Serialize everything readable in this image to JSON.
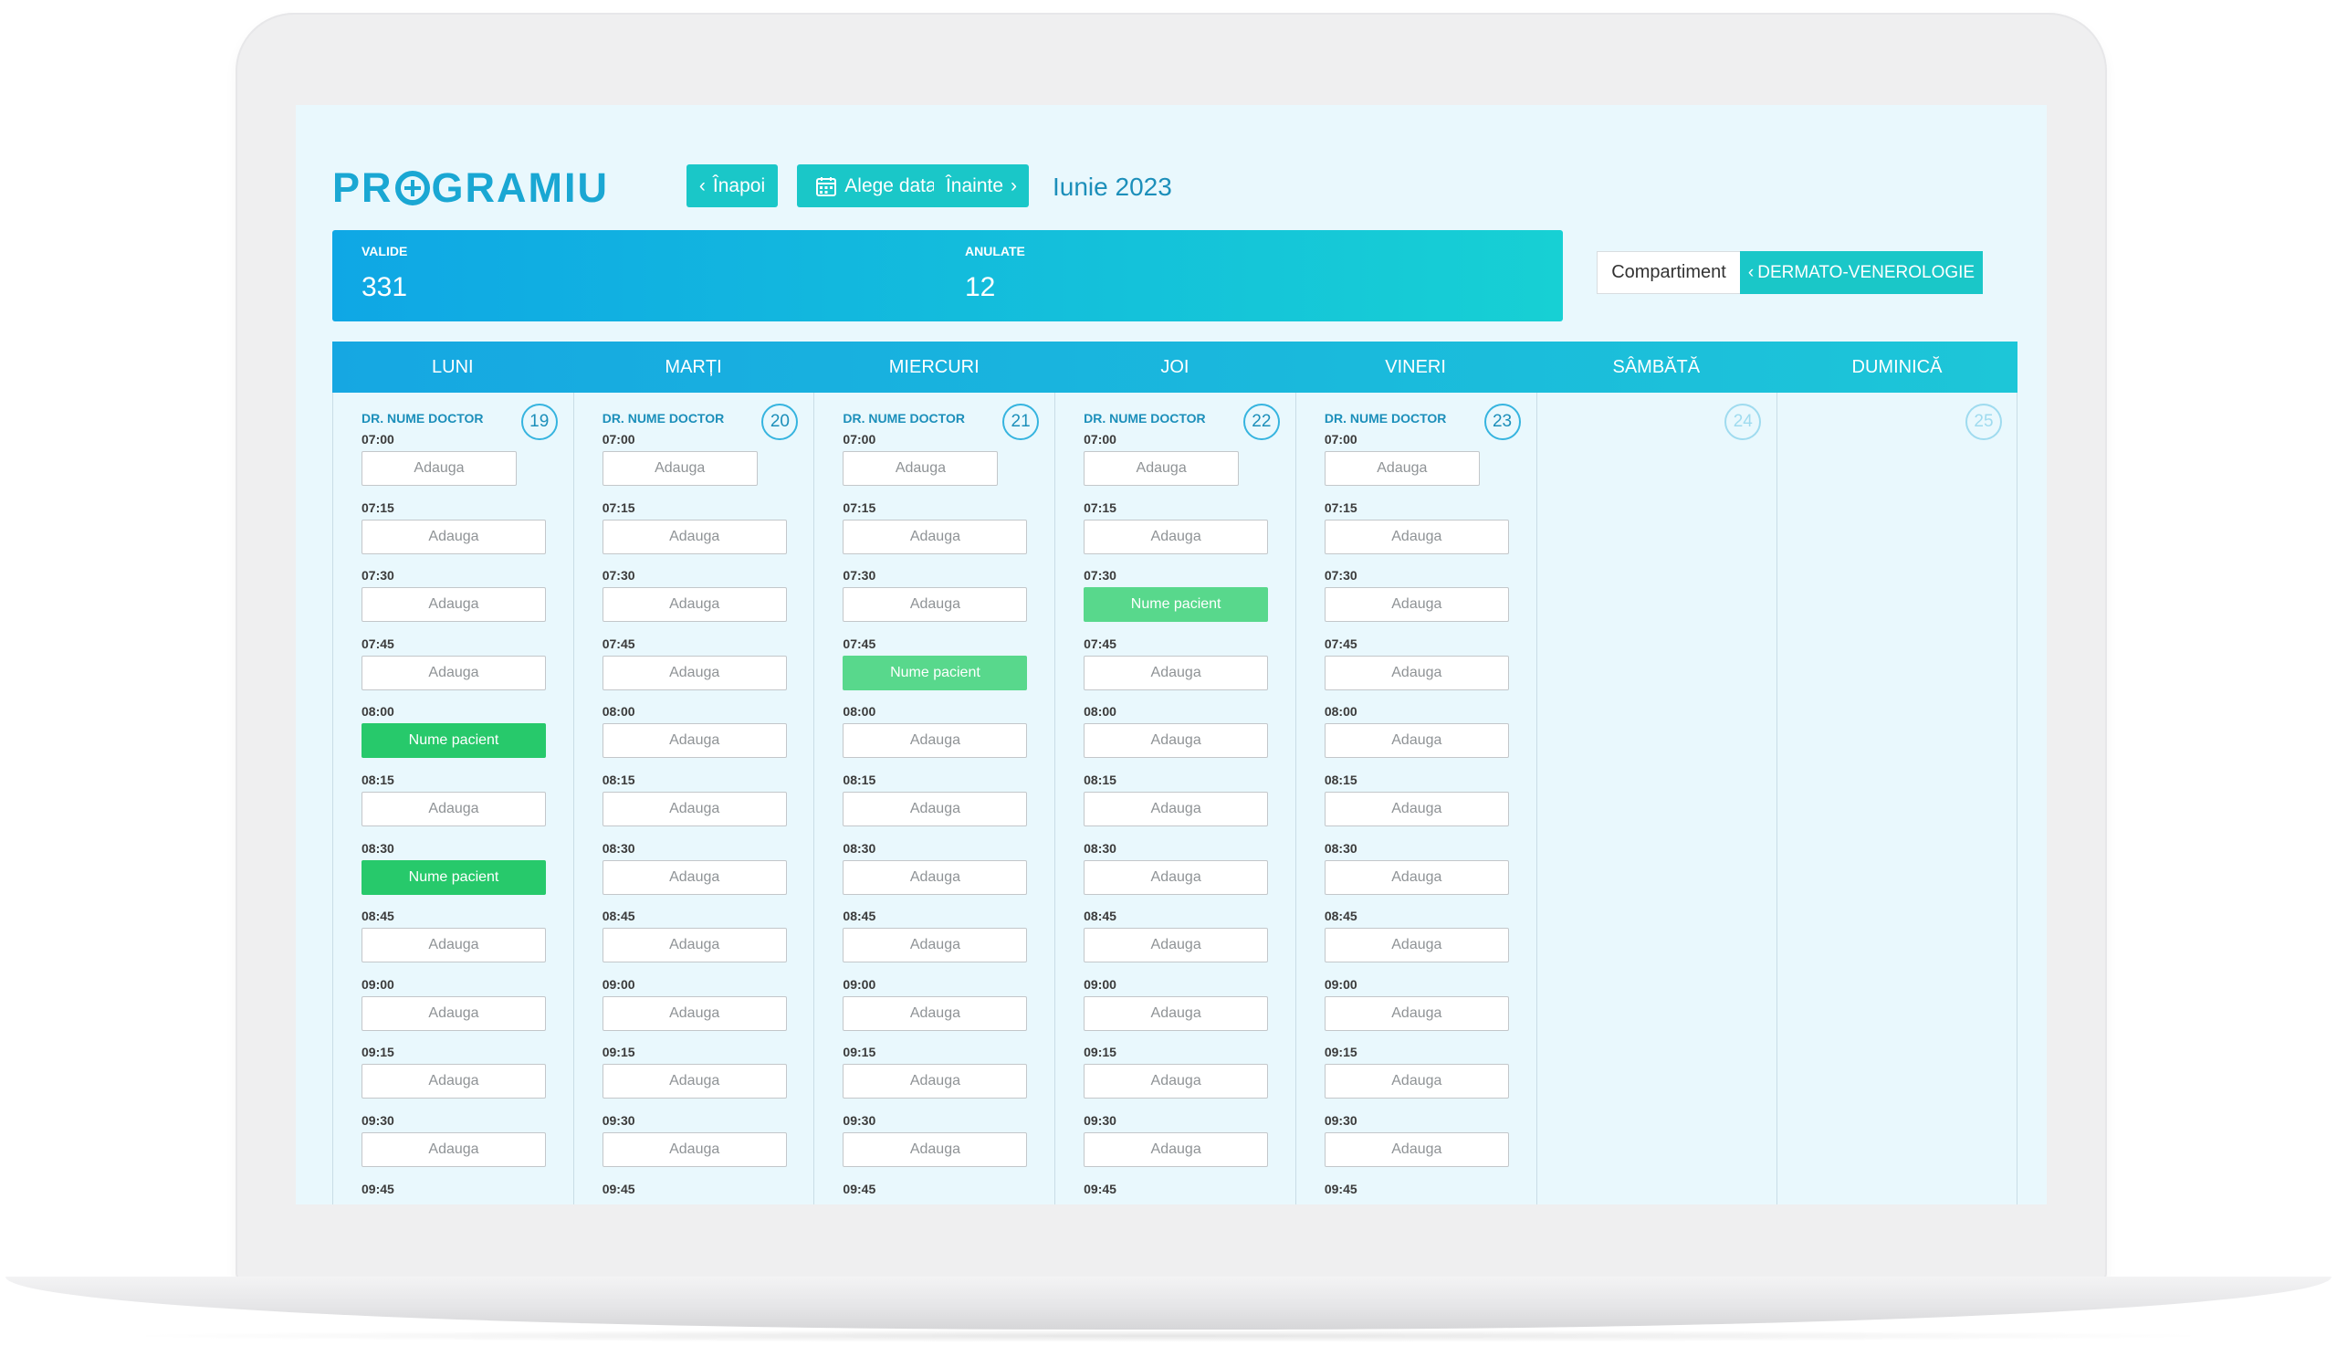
{
  "app": {
    "logo_part1": "PR",
    "logo_part2": "GRAMIU"
  },
  "toolbar": {
    "back_label": "Înapoi",
    "pick_date_label": "Alege data",
    "forward_label": "Înainte",
    "month_label": "Iunie 2023"
  },
  "stats": {
    "valid_label": "VALIDE",
    "valid_value": "331",
    "cancelled_label": "ANULATE",
    "cancelled_value": "12"
  },
  "department": {
    "label": "Compartiment",
    "value": "DERMATO-VENEROLOGIE"
  },
  "colors": {
    "accent": "#1ac7c8",
    "brand": "#1aa7d3",
    "booked_strong": "#27c96b",
    "booked_light": "#58d88c"
  },
  "icons": {
    "back": "chevron-left-icon",
    "calendar": "calendar-icon",
    "forward": "chevron-right-icon",
    "department": "chevron-left-icon",
    "logo_o": "medical-cross-icon"
  },
  "calendar": {
    "days": [
      {
        "name": "LUNI",
        "number": "19",
        "doctor": "DR. NUME DOCTOR",
        "weekend": false
      },
      {
        "name": "MARȚI",
        "number": "20",
        "doctor": "DR. NUME DOCTOR",
        "weekend": false
      },
      {
        "name": "MIERCURI",
        "number": "21",
        "doctor": "DR. NUME DOCTOR",
        "weekend": false
      },
      {
        "name": "JOI",
        "number": "22",
        "doctor": "DR. NUME DOCTOR",
        "weekend": false
      },
      {
        "name": "VINERI",
        "number": "23",
        "doctor": "DR. NUME DOCTOR",
        "weekend": false
      },
      {
        "name": "SÂMBĂTĂ",
        "number": "24",
        "doctor": "",
        "weekend": true
      },
      {
        "name": "DUMINICĂ",
        "number": "25",
        "doctor": "",
        "weekend": true
      }
    ],
    "times": [
      "07:00",
      "07:15",
      "07:30",
      "07:45",
      "08:00",
      "08:15",
      "08:30",
      "08:45",
      "09:00",
      "09:15",
      "09:30",
      "09:45"
    ],
    "add_label": "Adauga",
    "patient_label": "Nume pacient",
    "booked": [
      {
        "day": 0,
        "time": "08:00",
        "style": "strong"
      },
      {
        "day": 0,
        "time": "08:30",
        "style": "strong"
      },
      {
        "day": 2,
        "time": "07:45",
        "style": "light"
      },
      {
        "day": 3,
        "time": "07:30",
        "style": "light"
      }
    ]
  }
}
